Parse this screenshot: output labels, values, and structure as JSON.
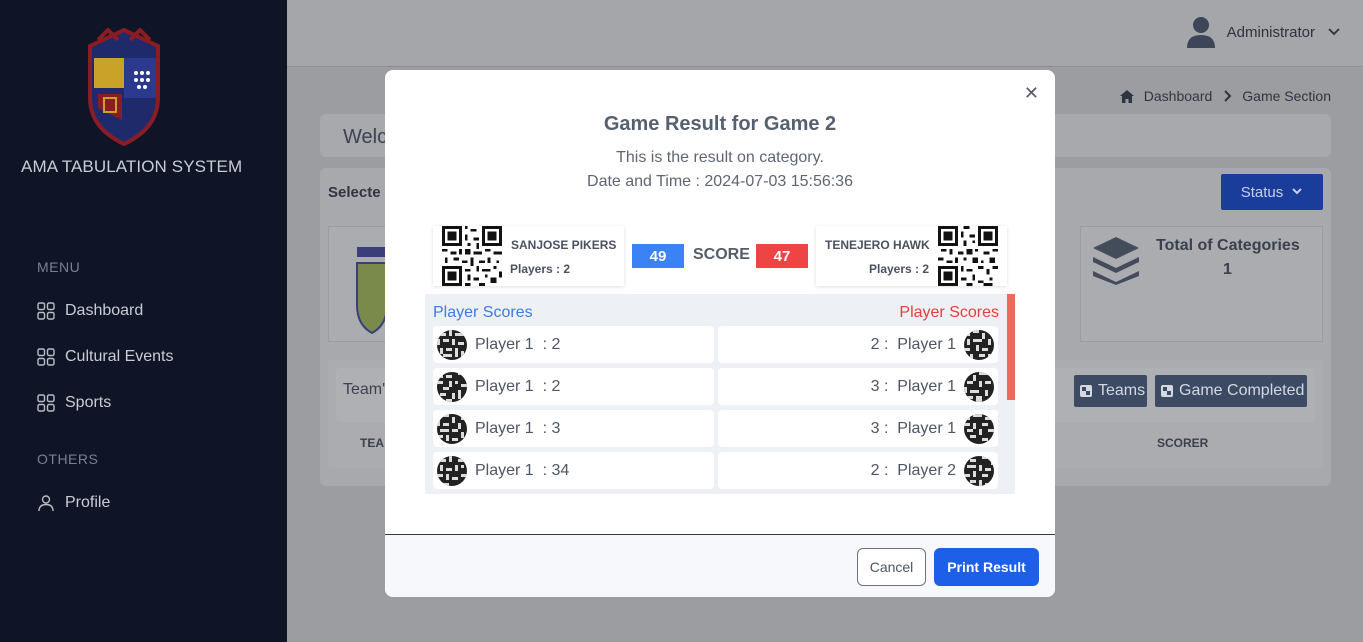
{
  "sidebar": {
    "brand": "AMA TABULATION SYSTEM",
    "menu_label": "MENU",
    "others_label": "OTHERS",
    "items": [
      {
        "label": "Dashboard"
      },
      {
        "label": "Cultural Events"
      },
      {
        "label": "Sports"
      }
    ],
    "profile": "Profile"
  },
  "header": {
    "user": "Administrator"
  },
  "breadcrumb": {
    "home": "Dashboard",
    "current": "Game Section"
  },
  "background": {
    "welcome": "Welco",
    "selected": "Selecte",
    "status_button": "Status",
    "total_categories_label": "Total of Categories",
    "total_categories_value": "1",
    "teams_label": "Team'",
    "teams_button": "Teams",
    "game_completed_button": "Game Completed",
    "col_team": "TEA",
    "col_scorer": "SCORER"
  },
  "modal": {
    "title": "Game Result for Game 2",
    "subtitle": "This is the result on category.",
    "datetime": "Date and Time : 2024-07-03 15:56:36",
    "team_left": {
      "name": "SANJOSE PIKERS",
      "players": "Players : 2",
      "score": "49"
    },
    "team_right": {
      "name": "TENEJERO HAWK",
      "players": "Players : 2",
      "score": "47"
    },
    "score_label": "SCORE",
    "player_scores_left": "Player Scores",
    "player_scores_right": "Player Scores",
    "left_rows": [
      {
        "text": "Player 1  : 2"
      },
      {
        "text": "Player 1  : 2"
      },
      {
        "text": "Player 1  : 3"
      },
      {
        "text": "Player 1  : 34"
      }
    ],
    "right_rows": [
      {
        "text": "2 :  Player 1"
      },
      {
        "text": "3 :  Player 1"
      },
      {
        "text": "3 :  Player 1"
      },
      {
        "text": "2 :  Player 2"
      }
    ],
    "cancel": "Cancel",
    "print": "Print Result"
  },
  "colors": {
    "sidebar_bg": "#0f1526",
    "left_score": "#3b82f6",
    "right_score": "#ef4444",
    "primary_button": "#1d5fe8"
  }
}
